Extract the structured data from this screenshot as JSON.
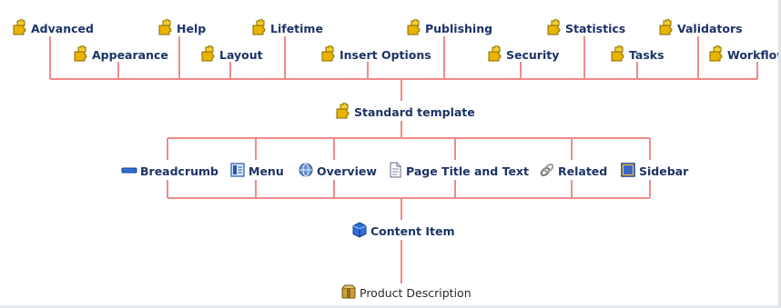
{
  "colors": {
    "connector": "#f08a8a",
    "label": "#1c3366",
    "leaf_label": "#2b2b2b"
  },
  "base_templates": [
    {
      "label": "Advanced",
      "icon": "puzzle-piece-icon"
    },
    {
      "label": "Appearance",
      "icon": "puzzle-piece-icon"
    },
    {
      "label": "Help",
      "icon": "puzzle-piece-icon"
    },
    {
      "label": "Layout",
      "icon": "puzzle-piece-icon"
    },
    {
      "label": "Lifetime",
      "icon": "puzzle-piece-icon"
    },
    {
      "label": "Insert Options",
      "icon": "puzzle-piece-icon"
    },
    {
      "label": "Publishing",
      "icon": "puzzle-piece-icon"
    },
    {
      "label": "Security",
      "icon": "puzzle-piece-icon"
    },
    {
      "label": "Statistics",
      "icon": "puzzle-piece-icon"
    },
    {
      "label": "Tasks",
      "icon": "puzzle-piece-icon"
    },
    {
      "label": "Validators",
      "icon": "puzzle-piece-icon"
    },
    {
      "label": "Workflow",
      "icon": "puzzle-piece-icon"
    }
  ],
  "standard_template": {
    "label": "Standard template",
    "icon": "puzzle-piece-icon"
  },
  "components": [
    {
      "label": "Breadcrumb",
      "icon": "breadcrumb-bar-icon"
    },
    {
      "label": "Menu",
      "icon": "menu-icon"
    },
    {
      "label": "Overview",
      "icon": "globe-icon"
    },
    {
      "label": "Page Title and Text",
      "icon": "document-icon"
    },
    {
      "label": "Related",
      "icon": "link-icon"
    },
    {
      "label": "Sidebar",
      "icon": "sidebar-icon"
    }
  ],
  "content_item": {
    "label": "Content Item",
    "icon": "cube-icon"
  },
  "product": {
    "label": "Product Description",
    "icon": "package-icon"
  }
}
